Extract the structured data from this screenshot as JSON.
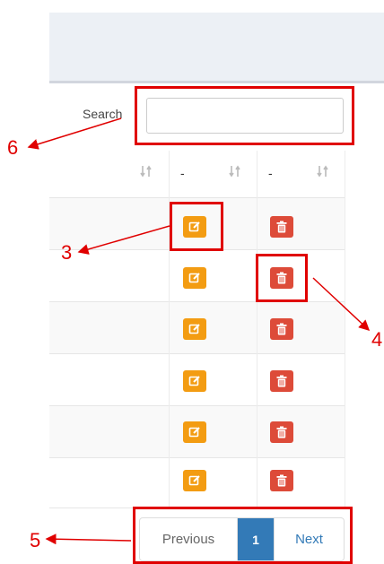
{
  "search": {
    "label": "Search",
    "value": ""
  },
  "table": {
    "headers": [
      "",
      "-",
      "-"
    ],
    "rows": 6
  },
  "pagination": {
    "previous": "Previous",
    "current": "1",
    "next": "Next"
  },
  "callouts": {
    "c3": "3",
    "c4": "4",
    "c5": "5",
    "c6": "6"
  },
  "colors": {
    "edit": "#f39c12",
    "delete": "#dd4b39",
    "annotation": "#e00000",
    "active_page": "#337ab7"
  },
  "icons": {
    "edit": "edit-icon",
    "delete": "trash-icon",
    "sort": "sort-icon"
  }
}
